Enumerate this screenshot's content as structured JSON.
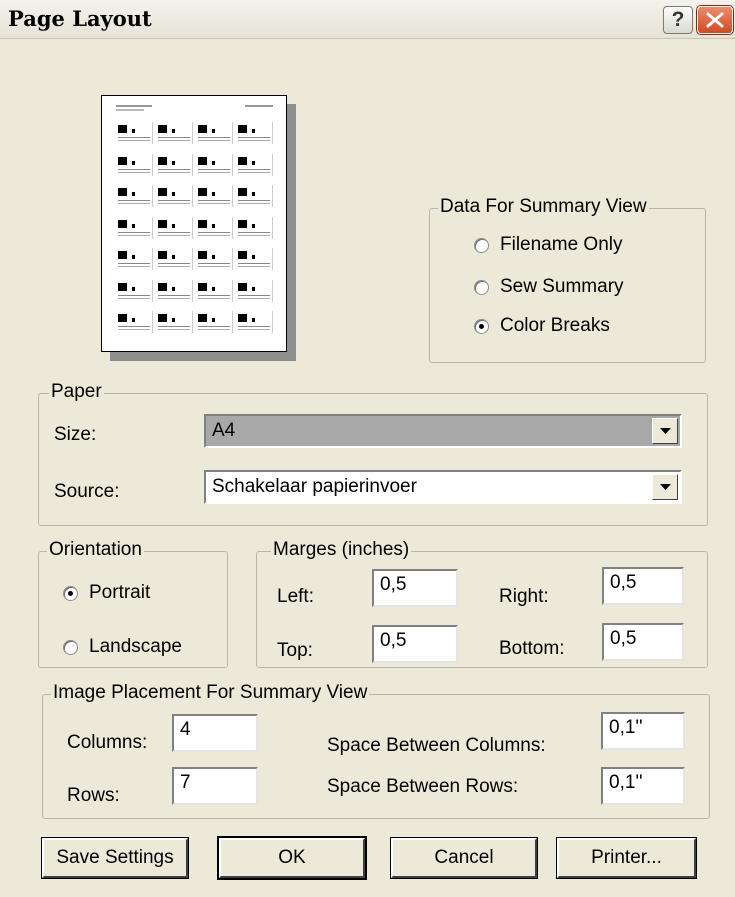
{
  "window": {
    "title": "Page Layout"
  },
  "summary_view": {
    "legend": "Data For Summary View",
    "options": [
      {
        "label": "Filename Only",
        "selected": false
      },
      {
        "label": "Sew Summary",
        "selected": false
      },
      {
        "label": "Color Breaks",
        "selected": true
      }
    ]
  },
  "paper": {
    "legend": "Paper",
    "size_label": "Size:",
    "size_value": "A4",
    "source_label": "Source:",
    "source_value": "Schakelaar papierinvoer"
  },
  "orientation": {
    "legend": "Orientation",
    "options": [
      {
        "label": "Portrait",
        "selected": true
      },
      {
        "label": "Landscape",
        "selected": false
      }
    ]
  },
  "margins": {
    "legend": "Marges (inches)",
    "left_label": "Left:",
    "left_value": "0,5",
    "right_label": "Right:",
    "right_value": "0,5",
    "top_label": "Top:",
    "top_value": "0,5",
    "bottom_label": "Bottom:",
    "bottom_value": "0,5"
  },
  "placement": {
    "legend": "Image Placement For Summary View",
    "columns_label": "Columns:",
    "columns_value": "4",
    "rows_label": "Rows:",
    "rows_value": "7",
    "col_space_label": "Space Between Columns:",
    "col_space_value": "0,1''",
    "row_space_label": "Space Between Rows:",
    "row_space_value": "0,1''"
  },
  "buttons": {
    "save": "Save Settings",
    "ok": "OK",
    "cancel": "Cancel",
    "printer": "Printer..."
  },
  "icons": {
    "help": "help-icon",
    "close": "close-icon"
  },
  "colors": {
    "dialog_bg": "#ECE9D8",
    "combo_selected_bg": "#A8A8A8",
    "close_red": "#D24A20"
  }
}
